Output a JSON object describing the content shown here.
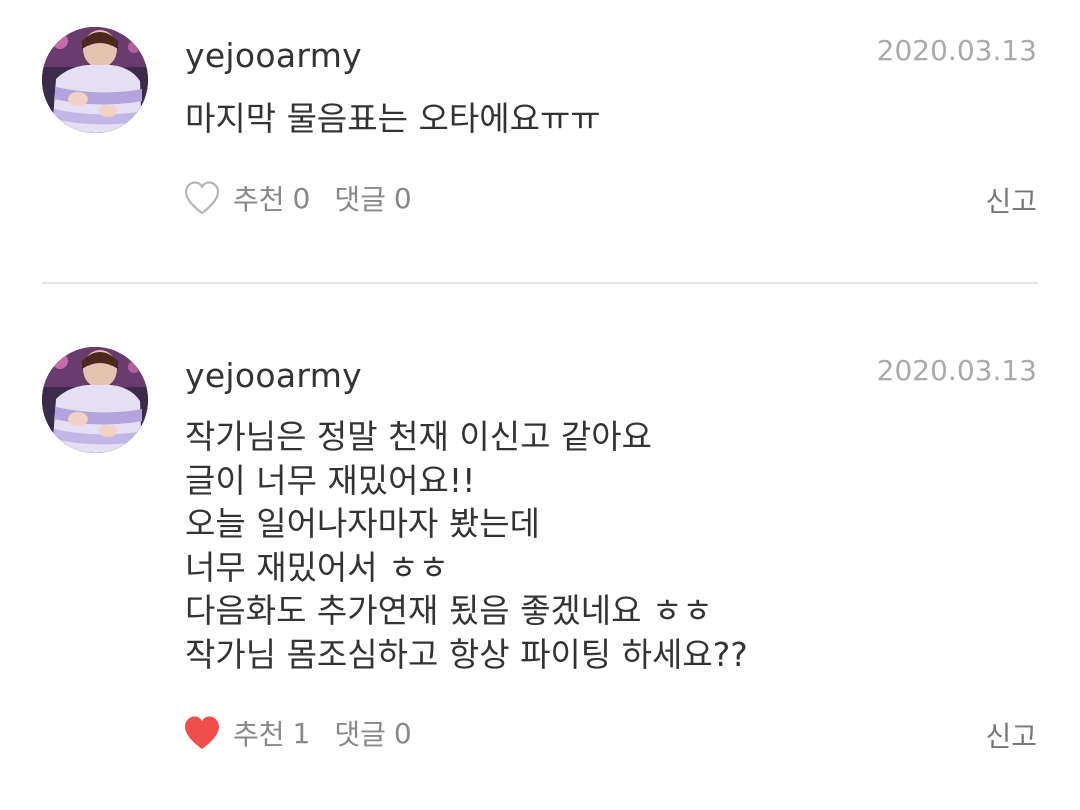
{
  "colors": {
    "liked_heart": "#f04d4d",
    "unliked_heart_stroke": "#b5b5b5",
    "text": "#333333",
    "meta": "#aaaaaa",
    "divider": "#e6e6e6"
  },
  "comments": [
    {
      "username": "yejooarmy",
      "date": "2020.03.13",
      "lines": [
        "마지막 물음표는 오타에요ㅠㅠ"
      ],
      "like_label": "추천",
      "like_count": "0",
      "reply_label": "댓글",
      "reply_count": "0",
      "report_label": "신고",
      "liked": false,
      "heart_icon": "heart-outline-icon"
    },
    {
      "username": "yejooarmy",
      "date": "2020.03.13",
      "lines": [
        "작가님은 정말 천재 이신고 같아요",
        "글이 너무 재밌어요!!",
        "오늘 일어나자마자 봤는데",
        "너무 재밌어서 ㅎㅎ",
        "다음화도 추가연재 됬음 좋겠네요 ㅎㅎ",
        "작가님 몸조심하고 항상 파이팅 하세요??"
      ],
      "like_label": "추천",
      "like_count": "1",
      "reply_label": "댓글",
      "reply_count": "0",
      "report_label": "신고",
      "liked": true,
      "heart_icon": "heart-filled-icon"
    }
  ]
}
